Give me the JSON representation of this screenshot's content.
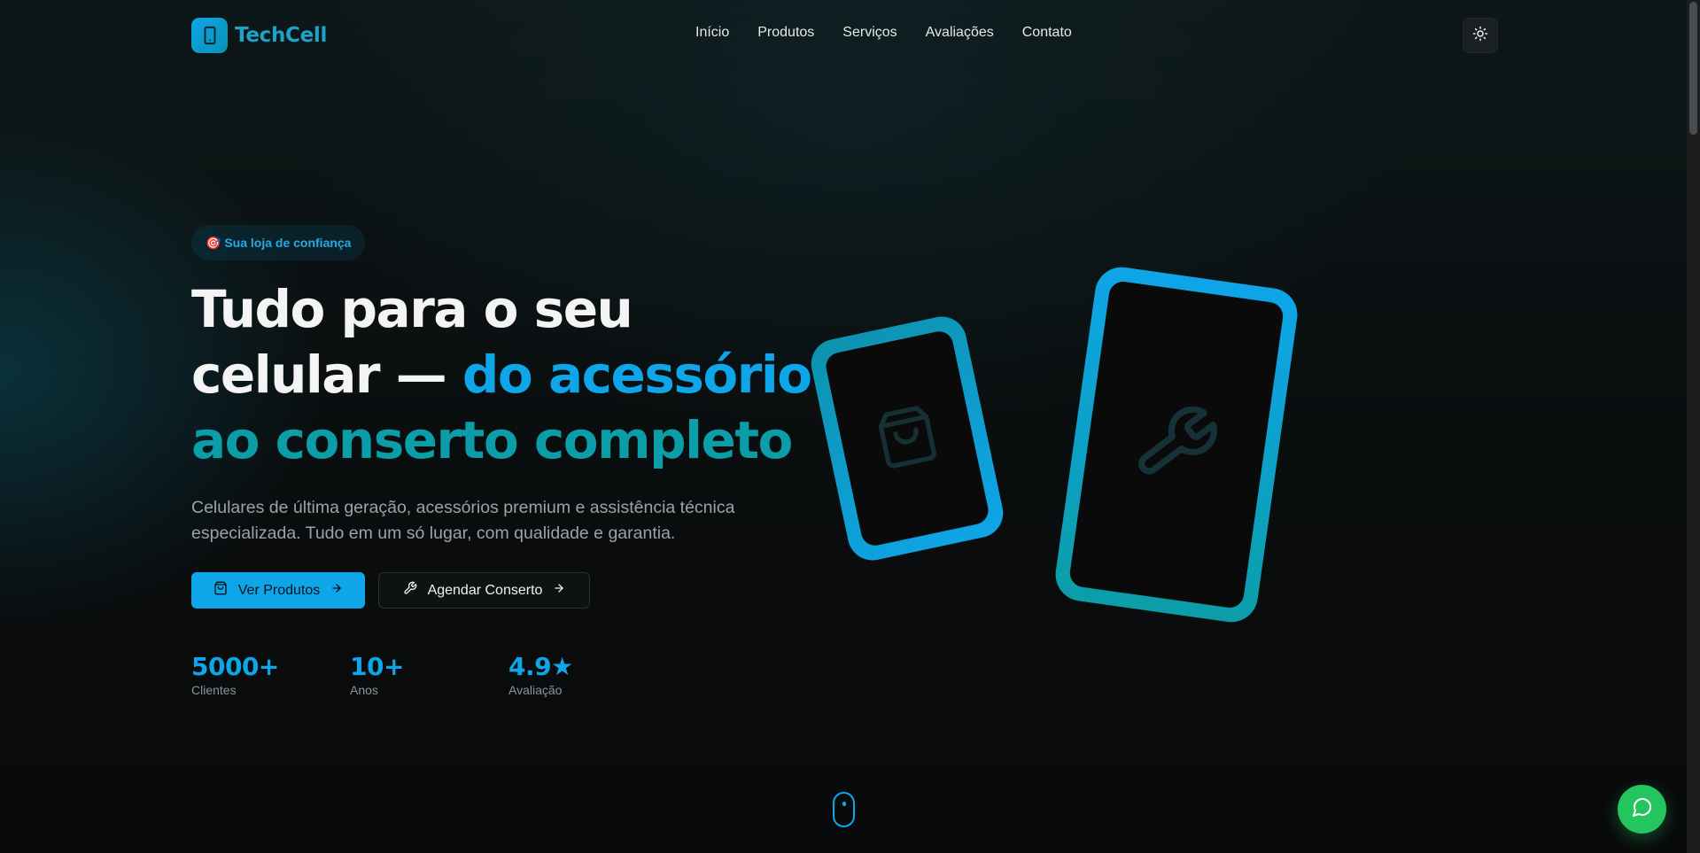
{
  "brand": {
    "name": "TechCell",
    "icon": "smartphone-icon",
    "accent": "#0ea5e9"
  },
  "nav": {
    "items": [
      {
        "label": "Início"
      },
      {
        "label": "Produtos"
      },
      {
        "label": "Serviços"
      },
      {
        "label": "Avaliações"
      },
      {
        "label": "Contato"
      }
    ],
    "theme_toggle_icon": "sun-icon"
  },
  "hero": {
    "badge": "🎯 Sua loja de confiança",
    "headline": {
      "line1": "Tudo para o seu",
      "line2_white": "celular — ",
      "line2_blue": "do acessório",
      "line3": "ao conserto completo"
    },
    "subtitle_line1": "Celulares de última geração, acessórios premium e assistência técnica",
    "subtitle_line2": "especializada. Tudo em um só lugar, com qualidade e garantia.",
    "primary_button": "Ver Produtos",
    "secondary_button": "Agendar Conserto"
  },
  "stats": [
    {
      "value": "5000+",
      "label": "Clientes"
    },
    {
      "value": "10+",
      "label": "Anos"
    },
    {
      "value": "4.9★",
      "label": "Avaliação"
    }
  ],
  "colors": {
    "primary": "#0ea5e9",
    "teal": "#0b9ea8",
    "whatsapp": "#22c55e",
    "background": "#0a0c0d"
  }
}
